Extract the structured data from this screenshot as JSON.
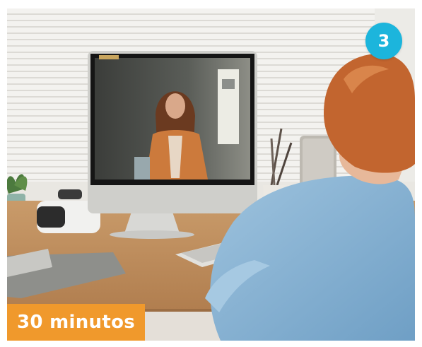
{
  "card": {
    "badge": {
      "text": "3",
      "color": "#1cb5dc"
    },
    "duration": {
      "text": "30 minutos",
      "color": "#f0992c"
    }
  }
}
